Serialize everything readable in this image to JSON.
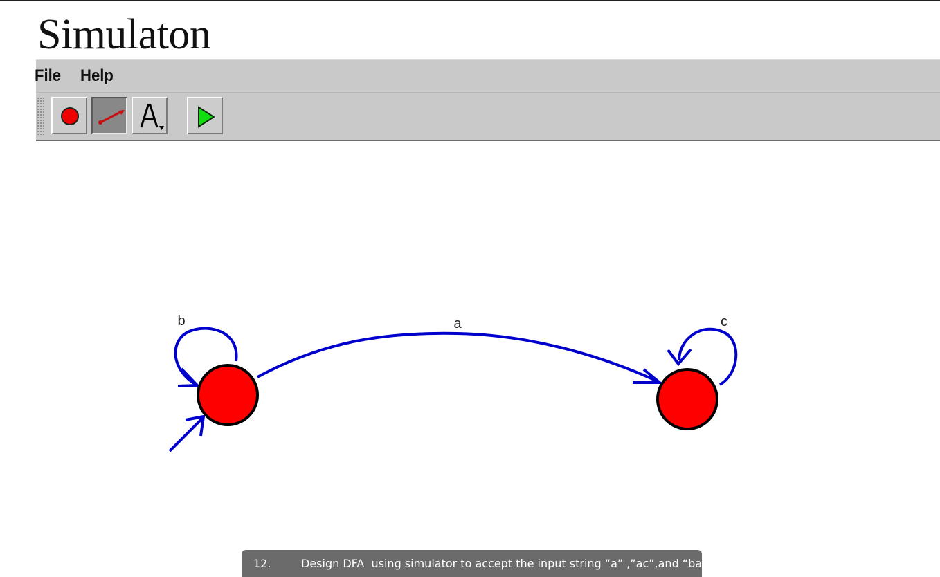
{
  "app": {
    "title": "Simulaton"
  },
  "menu": {
    "file_label": "File",
    "help_label": "Help"
  },
  "toolbar": {
    "tools": [
      {
        "name": "state-tool",
        "icon": "red-circle-icon",
        "pressed": false
      },
      {
        "name": "transition-tool",
        "icon": "arrow-line-icon",
        "pressed": true
      },
      {
        "name": "label-tool",
        "icon": "letter-a-icon",
        "pressed": false
      },
      {
        "name": "run-tool",
        "icon": "green-play-icon",
        "pressed": false
      }
    ]
  },
  "diagram": {
    "states": [
      {
        "id": "q0",
        "initial": true,
        "final": false
      },
      {
        "id": "q1",
        "initial": false,
        "final": false
      }
    ],
    "transitions": [
      {
        "from": "q0",
        "to": "q0",
        "label": "b"
      },
      {
        "from": "q0",
        "to": "q1",
        "label": "a"
      },
      {
        "from": "q1",
        "to": "q1",
        "label": "c"
      }
    ],
    "colors": {
      "state_fill": "#ff0000",
      "edge": "#0000cc"
    }
  },
  "caption": {
    "number": "12.",
    "text": "Design DFA  using simulator to accept the input string “a” ,”ac”,and “bac”."
  }
}
